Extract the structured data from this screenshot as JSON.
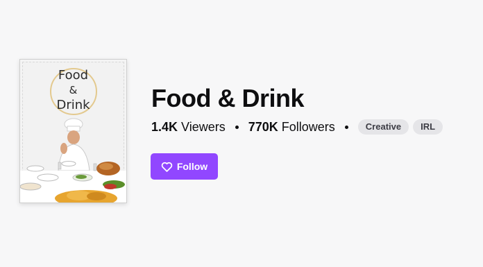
{
  "category": {
    "cover_lines": [
      "Food",
      "&",
      "Drink"
    ],
    "title": "Food & Drink",
    "viewers_count": "1.4K",
    "viewers_label": "Viewers",
    "followers_count": "770K",
    "followers_label": "Followers",
    "tags": [
      "Creative",
      "IRL"
    ]
  },
  "follow_button": {
    "label": "Follow",
    "icon": "heart-icon"
  },
  "colors": {
    "accent": "#9147ff",
    "background": "#f7f7f8",
    "tag_bg": "#e5e5e8",
    "text": "#0e0e10"
  }
}
